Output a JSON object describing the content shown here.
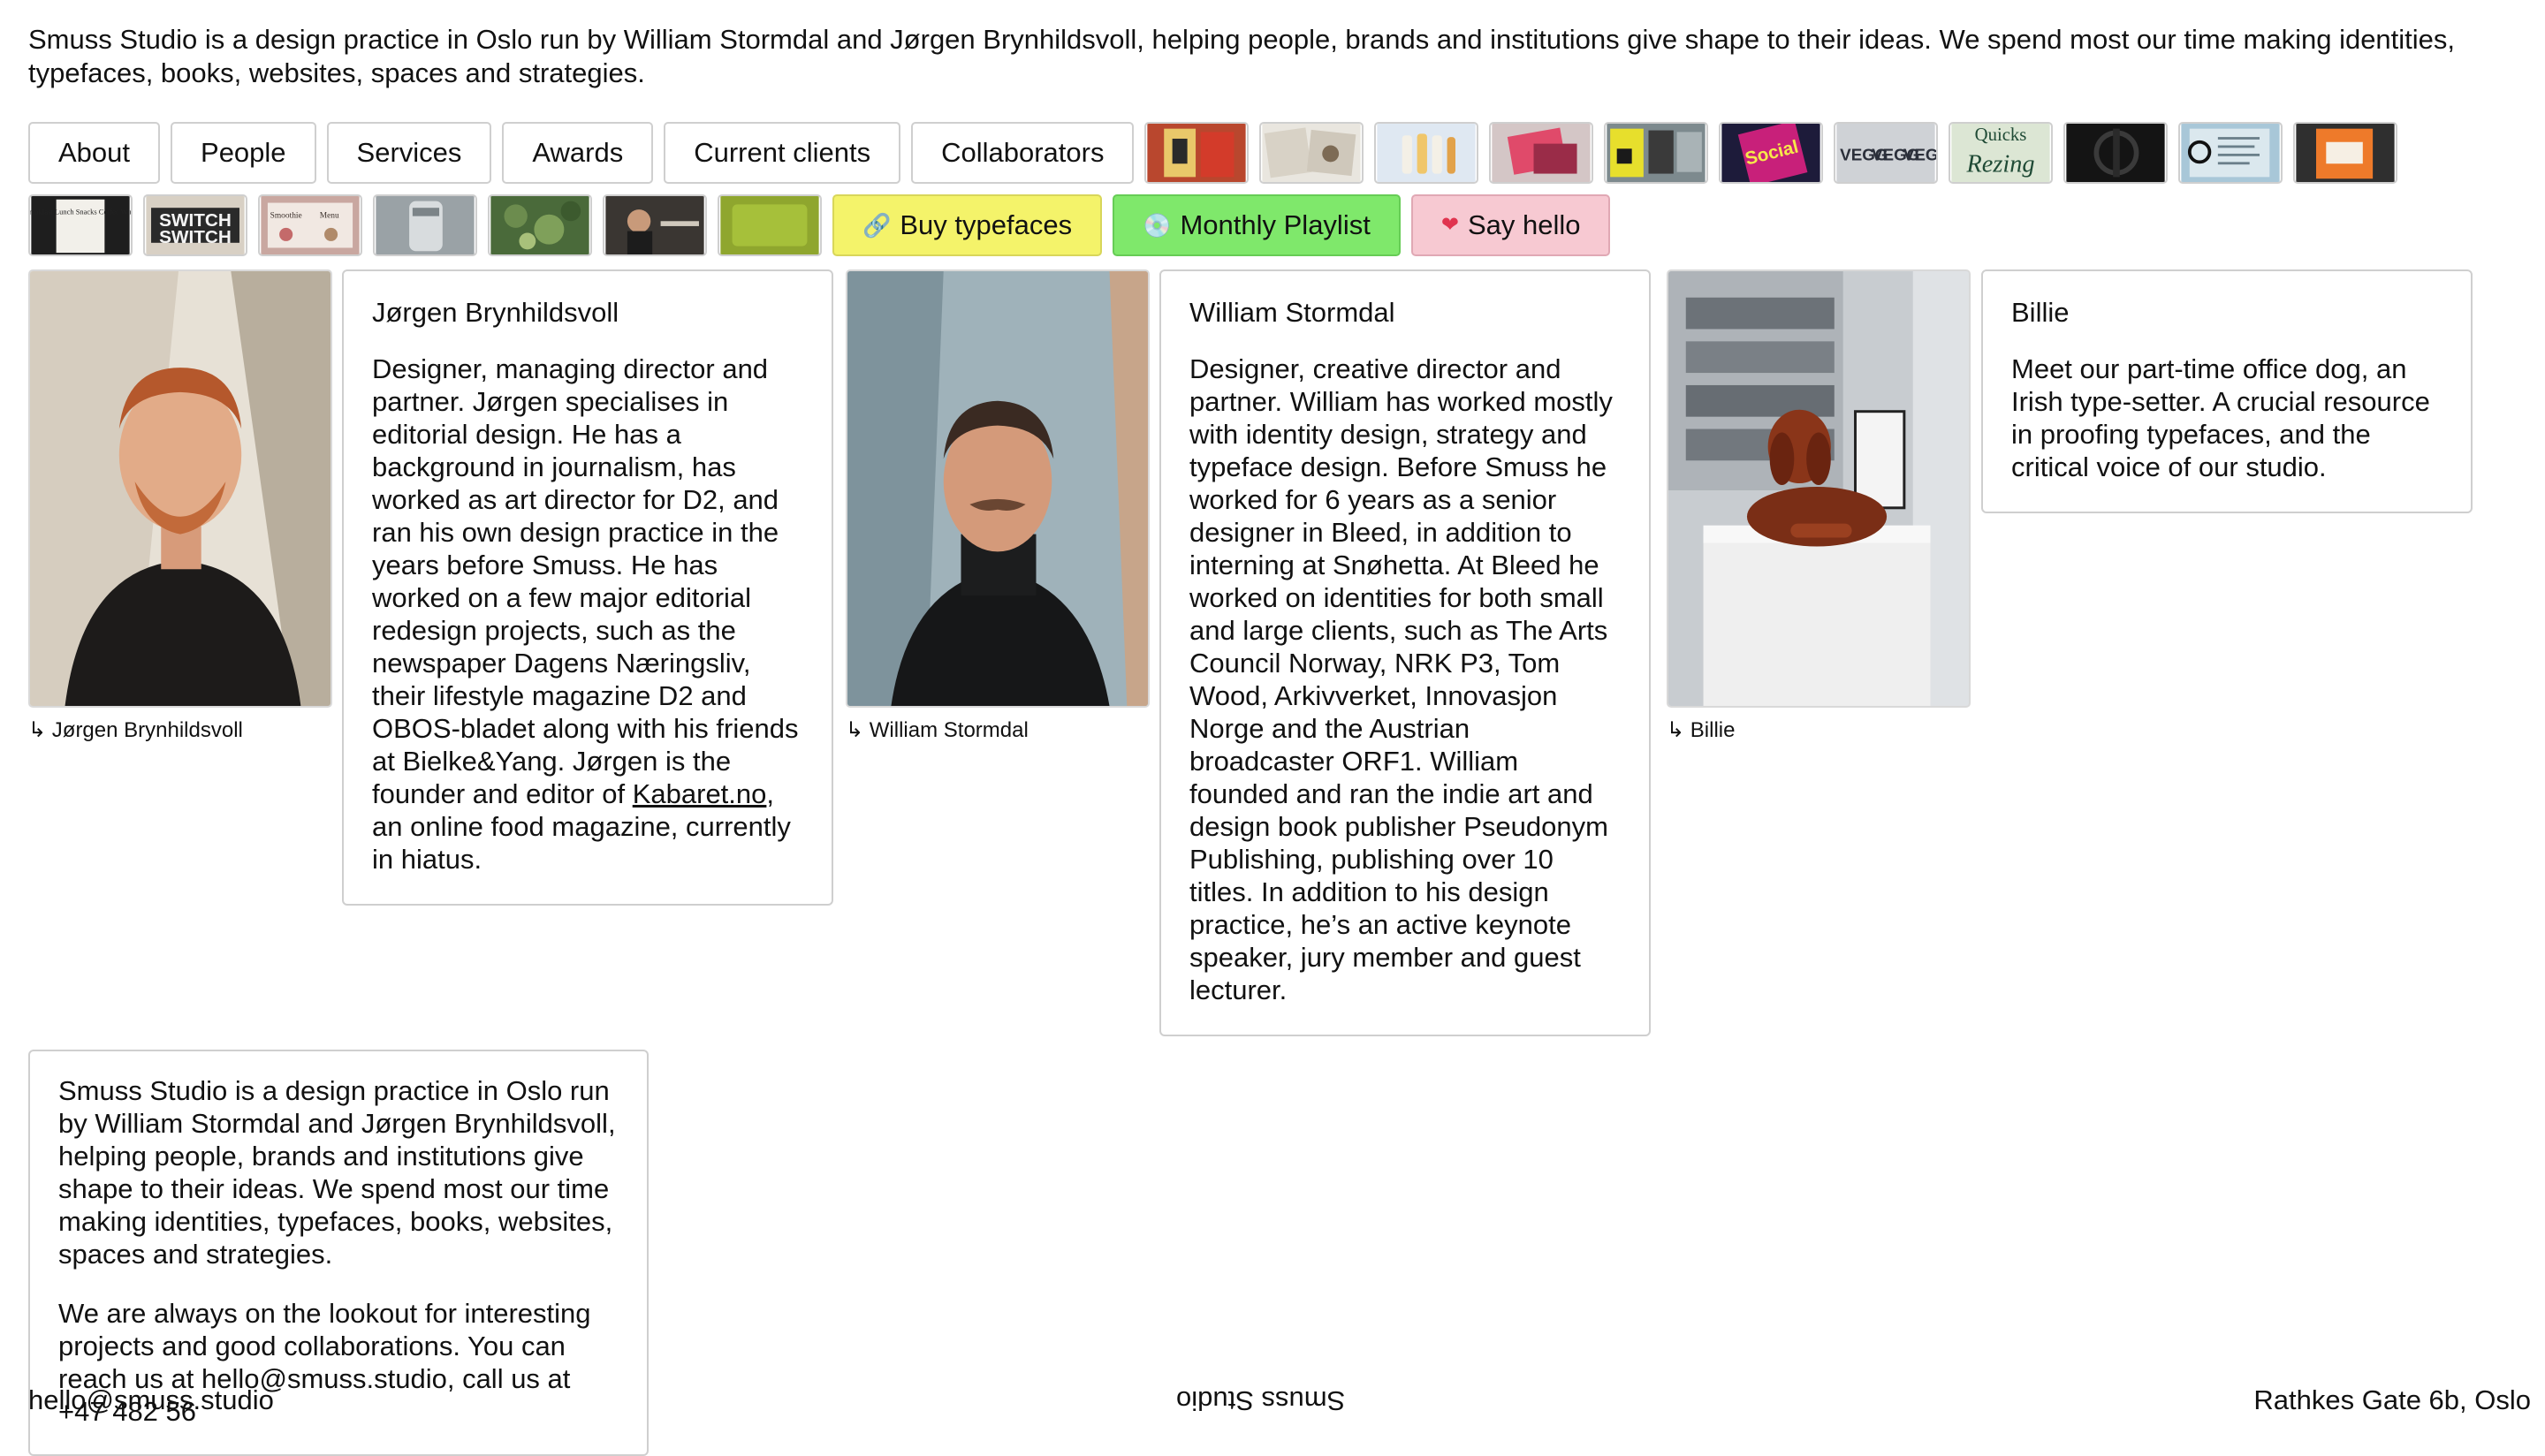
{
  "intro_text": "Smuss Studio is a design practice in Oslo run by William Stormdal and Jørgen Brynhildsvoll, helping people, brands and institutions give shape to their ideas. We spend most our time making identities, typefaces, books, websites, spaces and strategies.",
  "nav": {
    "about": "About",
    "people": "People",
    "services": "Services",
    "awards": "Awards",
    "current_clients": "Current clients",
    "collaborators": "Collaborators"
  },
  "thumb_texts": {
    "veggs": "VEGG",
    "quicks": "Quicks",
    "rezing": "Rezing",
    "switch": "SWITCH",
    "menu": "Breakfast Lunch Snacks Coffee Wine",
    "smoothie": "Smoothie",
    "menu_label": "Menu"
  },
  "actions": {
    "buy_typefaces": "Buy typefaces",
    "monthly_playlist": "Monthly Playlist",
    "say_hello": "Say hello"
  },
  "people": {
    "jorgen": {
      "caption": "↳ Jørgen Brynhildsvoll",
      "name": "Jørgen Brynhildsvoll",
      "bio_before_link": "Designer, managing director and partner. Jørgen specialises in editorial design. He has a background in journalism, has worked as art director for D2, and ran his own design practice in the years before Smuss. He has worked on a few major editorial redesign projects, such as the newspaper Dagens Næringsliv, their lifestyle magazine D2 and OBOS-bladet along with his friends at Bielke&Yang. Jørgen is the founder and editor of ",
      "bio_link": "Kabaret.no",
      "bio_after_link": ", an online food magazine, currently in hiatus."
    },
    "william": {
      "caption": "↳ William Stormdal",
      "name": "William Stormdal",
      "bio": "Designer, creative director and partner. William has worked mostly with identity design, strategy and typeface design. Before Smuss he worked for 6 years as a senior designer in Bleed, in addition to interning at Snøhetta. At Bleed he worked on identities for both small and large clients, such as The Arts Council Norway, NRK P3, Tom Wood, Arkivverket, Innovasjon Norge and the Austrian broadcaster ORF1. William founded and ran the indie art and design book publisher Pseudonym Publishing, publishing over 10 titles. In addition to his design practice, he’s an active keynote speaker, jury member and guest lecturer."
    },
    "billie": {
      "caption": "↳ Billie",
      "name": "Billie",
      "bio": "Meet our part-time office dog, an Irish type-setter. A crucial resource in proofing typefaces, and the critical voice of our studio."
    }
  },
  "about_card": {
    "p1": "Smuss Studio is a design practice in Oslo run by William Stormdal and Jørgen Brynhildsvoll, helping people, brands and institutions give shape to their ideas. We spend most our time making identities, typefaces, books, websites, spaces and strategies.",
    "p2": "We are always on the lookout for interesting projects and good collaborations. You can reach us at hello@smuss.studio, call us at +47 482 56"
  },
  "footer": {
    "email": "hello@smuss.studio",
    "studio": "Smuss Studio",
    "address": "Rathkes Gate 6b, Oslo"
  },
  "colors": {
    "buy_bg": "#f4f36a",
    "playlist_bg": "#7fe86b",
    "hello_bg": "#f7c9d2"
  },
  "icons": {
    "buy": "link-icon",
    "playlist": "cd-icon",
    "hello": "heart-icon"
  }
}
